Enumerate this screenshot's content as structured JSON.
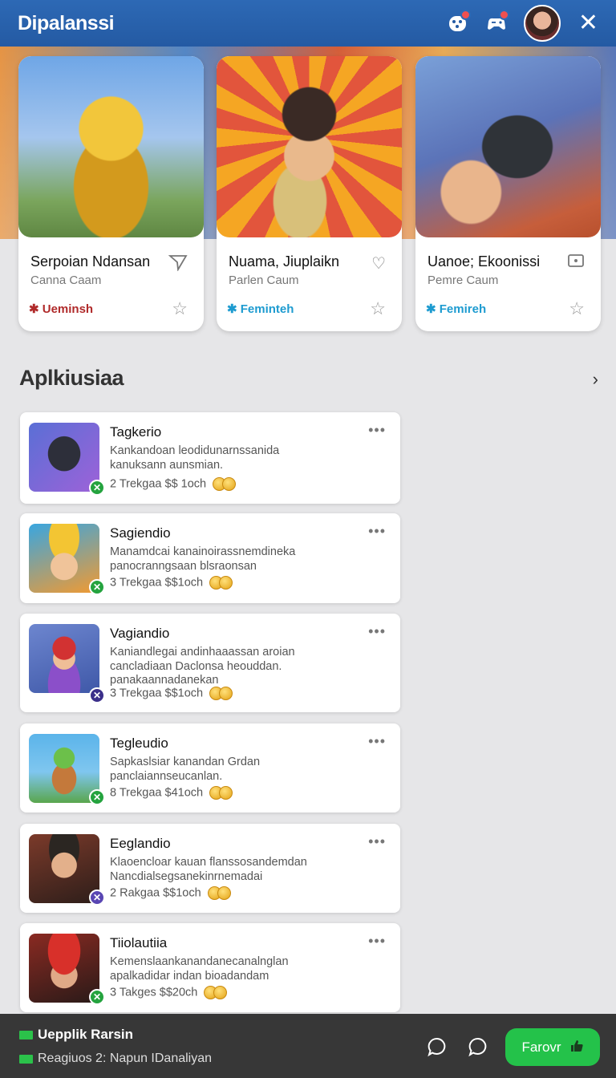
{
  "header": {
    "title": "Dipalanssi"
  },
  "featured": [
    {
      "name": "Serpoian Ndansan",
      "sub": "Canna Caam",
      "tag": "Ueminsh",
      "tag_icon": "✱",
      "tag_color": "#b02a2a",
      "action_icon": "send-icon"
    },
    {
      "name": "Nuama, Jiuplaikn",
      "sub": "Parlen Caum",
      "tag": "Feminteh",
      "tag_icon": "✱",
      "tag_color": "#1d9bd0",
      "action_icon": "heart-icon"
    },
    {
      "name": "Uanoe; Ekoonissi",
      "sub": "Pemre Caum",
      "tag": "Femireh",
      "tag_icon": "✱",
      "tag_color": "#1d9bd0",
      "action_icon": "screen-icon"
    }
  ],
  "section": {
    "title": "Aplkiusiaa"
  },
  "apps": [
    {
      "title": "Tagkerio",
      "desc": [
        "Kankandoan leodidunarnssanida",
        "kanuksann aunsmian."
      ],
      "meta": "2 Trekgaa  $$ 1och"
    },
    {
      "title": "Sagiendio",
      "desc": [
        "Manamdcai kanainoirassnemdineka",
        "panocranngsaan blsraonsan"
      ],
      "meta": "3 Trekgaa  $$1och"
    },
    {
      "title": "Vagiandio",
      "desc": [
        "Kaniandlegai andinhaaassan aroian",
        "cancladiaan Daclonsa heouddan.",
        "panakaannadanekan"
      ],
      "meta": "3 Trekgaa  $$1och"
    },
    {
      "title": "Tegleudio",
      "desc": [
        "Sapkaslsiar kanandan Grdan",
        "panclaiannseucanlan."
      ],
      "meta": "8 Trekgaa  $41och"
    },
    {
      "title": "Eeglandio",
      "desc": [
        "Klaoencloar kauan flanssosandemdan",
        "Nancdialsegsanekinrnemadai"
      ],
      "meta": "2 Rakgaa  $$1och"
    },
    {
      "title": "Tiiolautiia",
      "desc": [
        "Kemenslaankanandanecanalnglan",
        "apalkadidar indan bioadandam"
      ],
      "meta": "3 Takges  $$20ch"
    }
  ],
  "footer": {
    "line1": "Uepplik Rarsin",
    "line2": "Reagiuos 2:  Napun IDanaliyan",
    "fav_label": "Farovr"
  }
}
